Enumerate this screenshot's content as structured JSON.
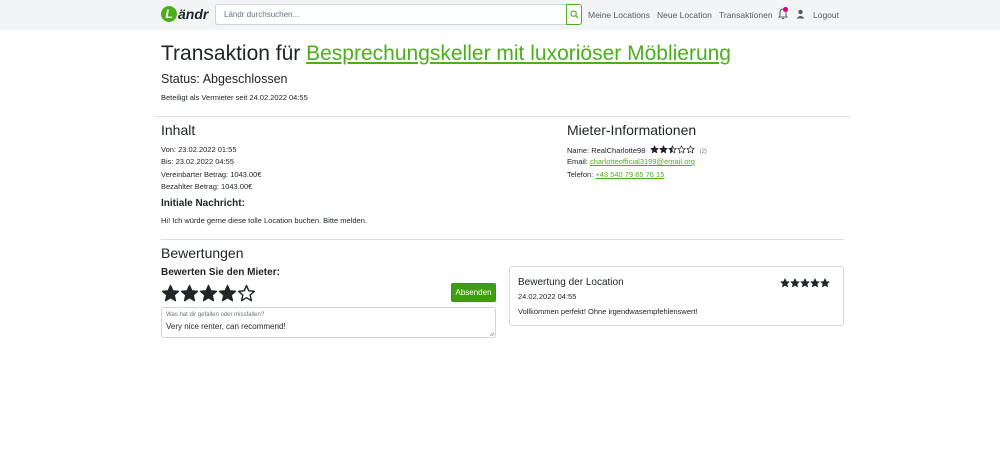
{
  "navbar": {
    "logo_letter": "L",
    "logo_text": "ändr",
    "search_placeholder": "Ländr durchsuchen...",
    "links": [
      "Meine Locations",
      "Neue Location",
      "Transaktionen"
    ],
    "logout": "Logout",
    "accent_color": "#4caf1a",
    "notification_dot_color": "#d6007a"
  },
  "header": {
    "title_prefix": "Transaktion für",
    "location_link": "Besprechungskeller mit luxoriöser Möblierung",
    "status": "Status: Abgeschlossen",
    "subline": "Beteiligt als Vermieter seit 24.02.2022 04:55"
  },
  "content": {
    "heading": "Inhalt",
    "from": "Von: 23.02.2022 01:55",
    "to": "Bis: 23.02.2022 04:55",
    "agreed": "Vereinbarter Betrag: 1043.00€",
    "paid": "Bezahlter Betrag: 1043.00€",
    "initial_heading": "Initiale Nachricht:",
    "initial_message": "Hi! Ich würde gerne diese tolle Location buchen. Bitte melden."
  },
  "tenant": {
    "heading": "Mieter-Informationen",
    "name_label": "Name:",
    "name": "RealCharlotte98",
    "rating": 2.5,
    "rating_count": "(2)",
    "email_label": "Email:",
    "email": "charlotteofficial3199@email.org",
    "phone_label": "Telefon:",
    "phone": "+43 540 79 65 76 15"
  },
  "reviews": {
    "heading": "Bewertungen",
    "rate_tenant_heading": "Bewerten Sie den Mieter:",
    "selected_stars": 4,
    "max_stars": 5,
    "submit_label": "Absenden",
    "comment_label": "Was hat dir gefallen oder missfallen?",
    "comment_value": "Very nice renter, can recommend!",
    "location_review": {
      "title": "Bewertung der Location",
      "date": "24.02.2022 04:55",
      "text": "Vollkommen perfekt! Ohne irgendwasempfehlenswert!",
      "stars": 5
    }
  }
}
